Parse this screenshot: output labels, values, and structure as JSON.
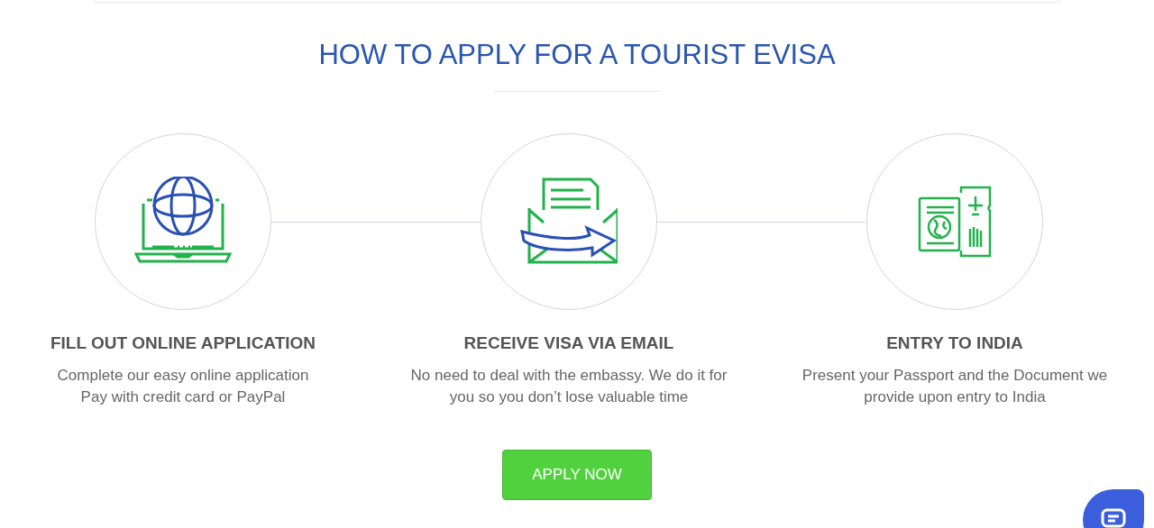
{
  "heading": "HOW TO APPLY FOR A TOURIST EVISA",
  "steps": [
    {
      "kind": "laptop",
      "title": "FILL OUT ONLINE APPLICATION",
      "lines": [
        "Complete our easy online application",
        "Pay with credit card or PayPal"
      ]
    },
    {
      "kind": "email",
      "title": "RECEIVE VISA VIA EMAIL",
      "lines": [
        "No need to deal with the embassy. We do it for",
        "you so you don’t lose valuable time"
      ]
    },
    {
      "kind": "passport",
      "title": "ENTRY TO INDIA",
      "lines": [
        "Present your Passport and the Document we",
        "provide upon entry to India"
      ]
    }
  ],
  "button": "APPLY NOW"
}
